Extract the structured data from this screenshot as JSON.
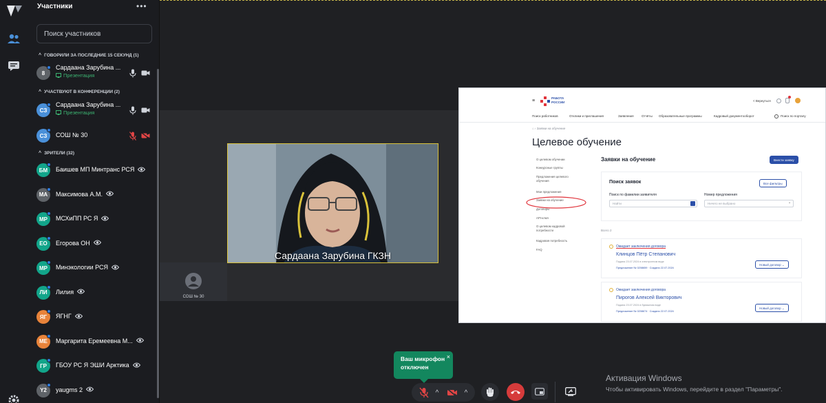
{
  "panel": {
    "title": "Участники",
    "more": "•••",
    "search_placeholder": "Поиск участников"
  },
  "sections": {
    "spoke": "ГОВОРИЛИ ЗА ПОСЛЕДНИЕ 15 СЕКУНД (1)",
    "in_conf": "УЧАСТВУЮТ В КОНФЕРЕНЦИИ (2)",
    "viewers": "ЗРИТЕЛИ (32)"
  },
  "spoke_list": [
    {
      "initials": "8",
      "name": "Сардаана Зарубина ...",
      "status": "Презентация",
      "color": "#5f6368"
    }
  ],
  "conf_list": [
    {
      "initials": "СЗ",
      "name": "Сардаана Зарубина ...",
      "status": "Презентация",
      "color": "#4a90d9"
    },
    {
      "initials": "СЗ",
      "name": "СОШ № 30",
      "status": "",
      "color": "#4a90d9"
    }
  ],
  "viewers": [
    {
      "initials": "БМ",
      "name": "Баишев МП Минтранс РСЯ",
      "color": "#12a58a"
    },
    {
      "initials": "МА",
      "name": "Максимова А.М.",
      "color": "#5f6368"
    },
    {
      "initials": "МР",
      "name": "МСХиПП РС Я",
      "color": "#12a58a"
    },
    {
      "initials": "ЕО",
      "name": "Егорова ОН",
      "color": "#12a58a"
    },
    {
      "initials": "МР",
      "name": "Минэкологии РСЯ",
      "color": "#12a58a"
    },
    {
      "initials": "ЛИ",
      "name": "Лилия",
      "color": "#12a58a"
    },
    {
      "initials": "ЯГ",
      "name": "ЯГНГ",
      "color": "#e8833a"
    },
    {
      "initials": "МЕ",
      "name": "Маргарита Еремеевна М...",
      "color": "#e8833a"
    },
    {
      "initials": "ГР",
      "name": "ГБОУ РС Я ЭШИ Арктика",
      "color": "#12a58a"
    },
    {
      "initials": "Y2",
      "name": "yaugms 2",
      "color": "#5f6368"
    }
  ],
  "stage": {
    "speaker_name": "Сардаана Зарубина ГКЗН",
    "tile_label": "СОШ № 30"
  },
  "shared_screen": {
    "logo_line1": "РАБОТА",
    "logo_line2": "РОССИИ",
    "nav": [
      "Поиск работников",
      "Отклики и приглашения",
      "Заявления",
      "Отчёты",
      "Образовательные программы",
      "Кадровый документооборот"
    ],
    "portal_search": "Поиск по порталу",
    "top_right": "< Вернуться",
    "breadcrumb": "Заявки на обучение",
    "page_title": "Целевое обучение",
    "side_menu": [
      "О целевом обучении",
      "Конкурсные группы",
      "Предложения целевого обучения",
      "Мои предложения",
      "Заявки на обучение",
      "Договоры",
      "API-ключ",
      "О целевом кадровой потребности",
      "Кадровая потребность",
      "FAQ"
    ],
    "section_title": "Заявки на обучение",
    "create_button": "Внести заявку",
    "search_title": "Поиск заявок",
    "filters_button": "Все фильтры",
    "label_lastname": "Поиск по фамилии заявителя",
    "label_offer": "Номер предложения",
    "lastname_placeholder": "Найти",
    "offer_placeholder": "Ничего не выбрано",
    "total": "Всего 2",
    "cards": [
      {
        "status": "Ожидает заключения договора",
        "name": "Клинцов Пётр Степанович",
        "meta": "Подана 23.07.2024 в электронном виде",
        "offer": "Предложение № 0208659 · Создано 22.07.2024",
        "action": "Новый договор"
      },
      {
        "status": "Ожидает заключения договора",
        "name": "Пирогов Алексей Викторович",
        "meta": "Подана 23.07.2024 в бумажном виде",
        "offer": "Предложение № 0208674 · Создано 22.07.2024",
        "action": "Новый договор"
      }
    ]
  },
  "toast": {
    "line1": "Ваш микрофон",
    "line2": "отключен",
    "close": "×"
  },
  "watermark": {
    "line1": "Активация Windows",
    "line2": "Чтобы активировать Windows, перейдите в раздел \"Параметры\"."
  },
  "colors": {
    "accent": "#2f7de1",
    "presentation": "#3cb371",
    "muted": "#e04545",
    "hangup": "#d63b3b",
    "toast": "#13875e",
    "speaker_border": "#d9c23a"
  }
}
